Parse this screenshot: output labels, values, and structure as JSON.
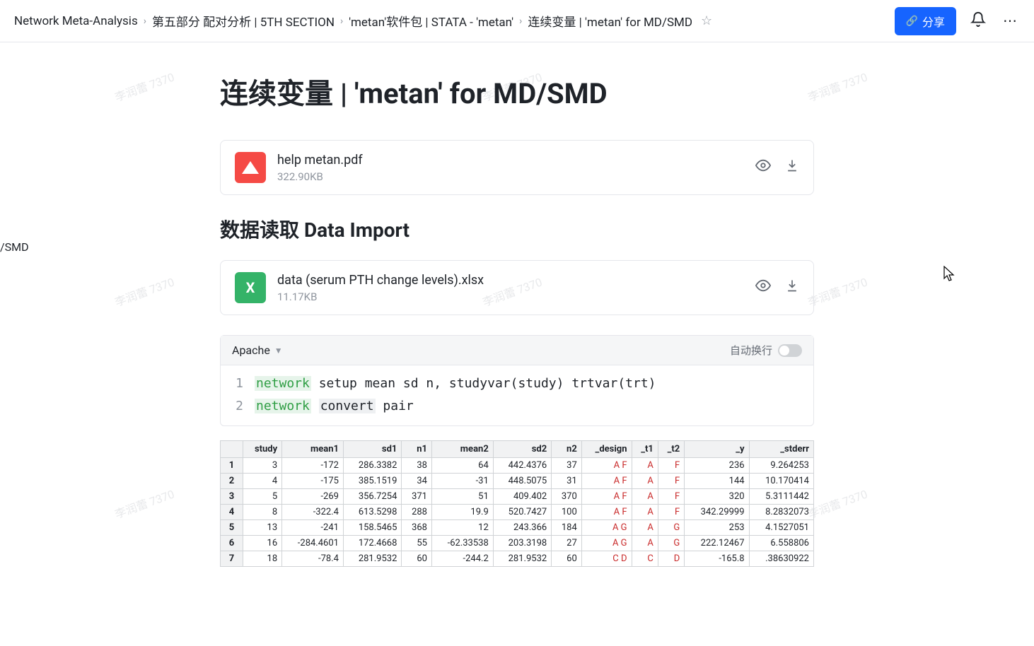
{
  "breadcrumb": {
    "items": [
      "Network Meta-Analysis",
      "第五部分 配对分析 | 5TH SECTION",
      "'metan'软件包 | STATA - 'metan'",
      "连续变量 | 'metan' for MD/SMD"
    ]
  },
  "share_label": "分享",
  "side_fragment": "/SMD",
  "page_title": "连续变量 | 'metan' for MD/SMD",
  "files": [
    {
      "name": "help metan.pdf",
      "size": "322.90KB",
      "type": "pdf"
    },
    {
      "name": "data (serum PTH change levels).xlsx",
      "size": "11.17KB",
      "type": "xlsx"
    }
  ],
  "section_heading": "数据读取 Data Import",
  "code": {
    "language": "Apache",
    "wrap_label": "自动换行",
    "lines": [
      {
        "n": "1",
        "tokens": [
          {
            "t": "network",
            "c": "kw-network"
          },
          {
            "t": " setup mean sd n, studyvar(study) trtvar(trt)",
            "c": ""
          }
        ]
      },
      {
        "n": "2",
        "tokens": [
          {
            "t": "network",
            "c": "kw-network"
          },
          {
            "t": " ",
            "c": ""
          },
          {
            "t": "convert",
            "c": "kw-convert"
          },
          {
            "t": " pair",
            "c": ""
          }
        ]
      }
    ]
  },
  "table": {
    "headers": [
      "",
      "study",
      "mean1",
      "sd1",
      "n1",
      "mean2",
      "sd2",
      "n2",
      "_design",
      "_t1",
      "_t2",
      "_y",
      "_stderr"
    ],
    "rows": [
      [
        "1",
        "3",
        "-172",
        "286.3382",
        "38",
        "64",
        "442.4376",
        "37",
        "A F",
        "A",
        "F",
        "236",
        "9.264253"
      ],
      [
        "2",
        "4",
        "-175",
        "385.1519",
        "34",
        "-31",
        "448.5075",
        "31",
        "A F",
        "A",
        "F",
        "144",
        "10.170414"
      ],
      [
        "3",
        "5",
        "-269",
        "356.7254",
        "371",
        "51",
        "409.402",
        "370",
        "A F",
        "A",
        "F",
        "320",
        "5.3111442"
      ],
      [
        "4",
        "8",
        "-322.4",
        "613.5298",
        "288",
        "19.9",
        "520.7427",
        "100",
        "A F",
        "A",
        "F",
        "342.29999",
        "8.2832073"
      ],
      [
        "5",
        "13",
        "-241",
        "158.5465",
        "368",
        "12",
        "243.366",
        "184",
        "A G",
        "A",
        "G",
        "253",
        "4.1527051"
      ],
      [
        "6",
        "16",
        "-284.4601",
        "172.4668",
        "55",
        "-62.33538",
        "203.3198",
        "27",
        "A G",
        "A",
        "G",
        "222.12467",
        "6.558806"
      ],
      [
        "7",
        "18",
        "-78.4",
        "281.9532",
        "60",
        "-244.2",
        "281.9532",
        "60",
        "C D",
        "C",
        "D",
        "-165.8",
        ".38630922"
      ]
    ]
  },
  "watermark_text": "李润蕾 7370"
}
